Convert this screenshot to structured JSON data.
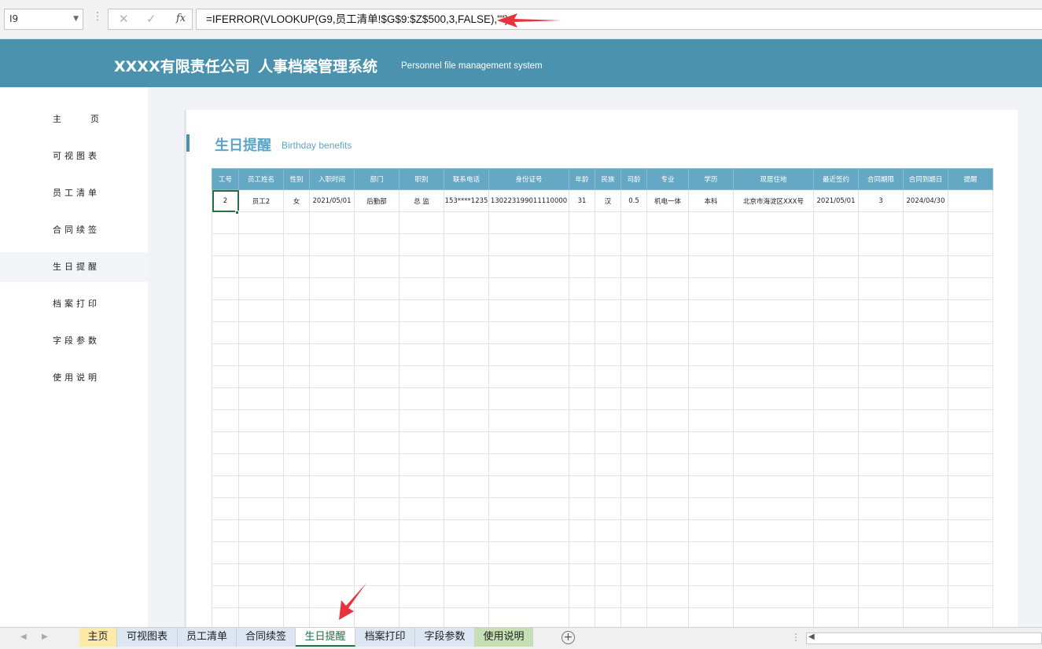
{
  "formula_bar": {
    "cell_ref": "I9",
    "formula": "=IFERROR(VLOOKUP(G9,员工清单!$G$9:$Z$500,3,FALSE),\"\")",
    "fx_label": "fx"
  },
  "header": {
    "company": "XXXX有限责任公司",
    "system": "人事档案管理系统",
    "system_en": "Personnel file management system"
  },
  "sidebar": {
    "items": [
      {
        "label": "主  页"
      },
      {
        "label": "可视图表"
      },
      {
        "label": "员工清单"
      },
      {
        "label": "合同续签"
      },
      {
        "label": "生日提醒"
      },
      {
        "label": "档案打印"
      },
      {
        "label": "字段参数"
      },
      {
        "label": "使用说明"
      }
    ],
    "active_index": 4
  },
  "section": {
    "title": "生日提醒",
    "subtitle": "Birthday benefits"
  },
  "table": {
    "columns": [
      "工号",
      "员工姓名",
      "性别",
      "入职时间",
      "部门",
      "职别",
      "联系电话",
      "身份证号",
      "年龄",
      "民族",
      "司龄",
      "专业",
      "学历",
      "现居住地",
      "最近签约",
      "合同期限",
      "合同到期日",
      "提醒"
    ],
    "rows": [
      [
        "2",
        "员工2",
        "女",
        "2021/05/01",
        "后勤部",
        "总 监",
        "153****1235",
        "130223199011110000",
        "31",
        "汉",
        "0.5",
        "机电一体",
        "本科",
        "北京市海淀区XXX号",
        "2021/05/01",
        "3",
        "2024/04/30",
        ""
      ]
    ],
    "empty_rows": 19
  },
  "sheet_tabs": [
    {
      "label": "主页",
      "color": "#fde9a8"
    },
    {
      "label": "可视图表",
      "color": "#dde7f3"
    },
    {
      "label": "员工清单",
      "color": "#dde7f3"
    },
    {
      "label": "合同续签",
      "color": "#dde7f3"
    },
    {
      "label": "生日提醒",
      "color": "#ffffff"
    },
    {
      "label": "档案打印",
      "color": "#dde7f3"
    },
    {
      "label": "字段参数",
      "color": "#dde7f3"
    },
    {
      "label": "使用说明",
      "color": "#c6e0b4"
    }
  ],
  "active_sheet_index": 4,
  "colors": {
    "banner": "#4a92ad",
    "header_row": "#65a8c3",
    "accent_text": "#5ba6c6",
    "selection": "#217346",
    "annotation": "#e8323c"
  }
}
